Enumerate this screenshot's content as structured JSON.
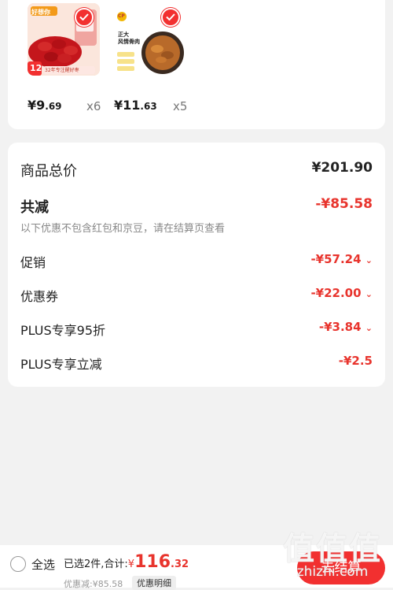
{
  "products": [
    {
      "box_brand": "好想你",
      "tag": "12",
      "note": "32年专注醒好枣",
      "price_main": "¥9",
      "price_decimal": ".69",
      "qty": "x6"
    },
    {
      "box_brand": "CP",
      "box_title": "正大\n风情骨肉",
      "price_main": "¥11",
      "price_decimal": ".63",
      "qty": "x5"
    }
  ],
  "summary": {
    "total_label": "商品总价",
    "total_value": "¥201.90",
    "reduce_label": "共减",
    "reduce_value": "-¥85.58",
    "reduce_note": "以下优惠不包含红包和京豆，请在结算页查看",
    "items": [
      {
        "label": "促销",
        "value": "-¥57.24"
      },
      {
        "label": "优惠券",
        "value": "-¥22.00"
      },
      {
        "label": "PLUS专享95折",
        "value": "-¥3.84"
      },
      {
        "label": "PLUS专享立减",
        "value": "-¥2.5"
      }
    ]
  },
  "bottom": {
    "select_all": "全选",
    "selected_text": "已选2件,合计:",
    "currency": "¥",
    "total_main": "116",
    "total_decimal": ".32",
    "discount_text": "优惠减:¥85.58",
    "detail_button": "优惠明细",
    "checkout": "去结算"
  },
  "watermark": {
    "logo_text": "值",
    "site": "zhizhi.com"
  },
  "colors": {
    "accent_red": "#e8342d",
    "button_red": "#f23030",
    "background": "#f2f2f2"
  }
}
